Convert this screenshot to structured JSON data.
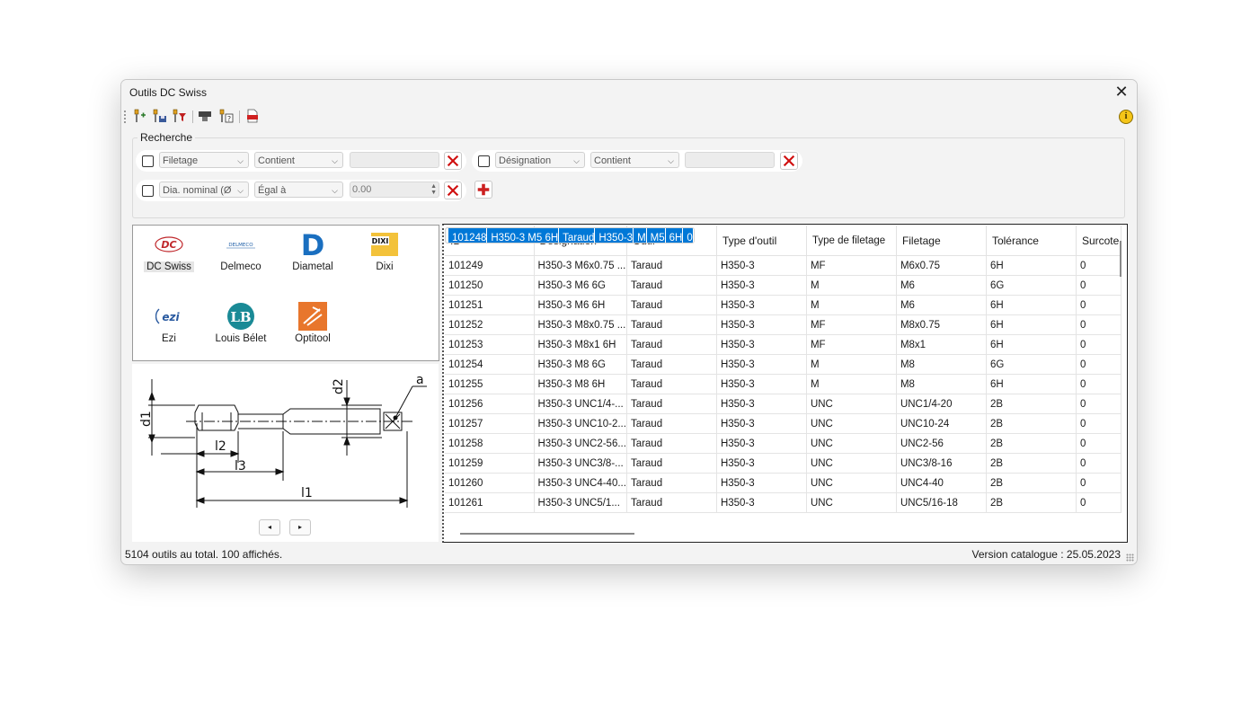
{
  "window": {
    "title": "Outils DC Swiss",
    "close_glyph": "✕"
  },
  "toolbar": {
    "icons": [
      "tool-add-icon",
      "tool-save-icon",
      "tool-filter-icon",
      "holder-icon",
      "tool-help-icon",
      "pdf-icon"
    ],
    "info_glyph": "i"
  },
  "search": {
    "label": "Recherche",
    "filters": [
      {
        "field": "Filetage",
        "op": "Contient",
        "value": ""
      },
      {
        "field": "Désignation",
        "op": "Contient",
        "value": ""
      },
      {
        "field": "Dia. nominal (Ø",
        "op": "Égal à",
        "value": "0.00"
      }
    ]
  },
  "brands": [
    {
      "name": "DC Swiss",
      "selected": true
    },
    {
      "name": "Delmeco"
    },
    {
      "name": "Diametal"
    },
    {
      "name": "Dixi"
    },
    {
      "name": "Ezi"
    },
    {
      "name": "Louis Bélet"
    },
    {
      "name": "Optitool"
    }
  ],
  "brand_logo_text": {
    "dc": "DC",
    "delmeco": "DELMECO",
    "diametal": "D",
    "dixi": "DIXI",
    "ezi": "ezi",
    "lb": "LB"
  },
  "drawing_labels": {
    "d1": "d1",
    "d2": "d2",
    "a": "a",
    "l1": "l1",
    "l2": "l2",
    "l3": "l3"
  },
  "nav": {
    "prev": "◂",
    "next": "▸"
  },
  "table": {
    "columns": [
      "ID",
      "Désignation",
      "Outil",
      "Type d'outil",
      "Type de filetage",
      "Filetage",
      "Tolérance",
      "Surcote"
    ],
    "rows": [
      [
        "101248",
        "H350-3 M5 6H",
        "Taraud",
        "H350-3",
        "M",
        "M5",
        "6H",
        "0"
      ],
      [
        "101249",
        "H350-3 M6x0.75 ...",
        "Taraud",
        "H350-3",
        "MF",
        "M6x0.75",
        "6H",
        "0"
      ],
      [
        "101250",
        "H350-3 M6 6G",
        "Taraud",
        "H350-3",
        "M",
        "M6",
        "6G",
        "0"
      ],
      [
        "101251",
        "H350-3 M6 6H",
        "Taraud",
        "H350-3",
        "M",
        "M6",
        "6H",
        "0"
      ],
      [
        "101252",
        "H350-3 M8x0.75 ...",
        "Taraud",
        "H350-3",
        "MF",
        "M8x0.75",
        "6H",
        "0"
      ],
      [
        "101253",
        "H350-3 M8x1 6H",
        "Taraud",
        "H350-3",
        "MF",
        "M8x1",
        "6H",
        "0"
      ],
      [
        "101254",
        "H350-3 M8 6G",
        "Taraud",
        "H350-3",
        "M",
        "M8",
        "6G",
        "0"
      ],
      [
        "101255",
        "H350-3 M8 6H",
        "Taraud",
        "H350-3",
        "M",
        "M8",
        "6H",
        "0"
      ],
      [
        "101256",
        "H350-3 UNC1/4-...",
        "Taraud",
        "H350-3",
        "UNC",
        "UNC1/4-20",
        "2B",
        "0"
      ],
      [
        "101257",
        "H350-3 UNC10-2...",
        "Taraud",
        "H350-3",
        "UNC",
        "UNC10-24",
        "2B",
        "0"
      ],
      [
        "101258",
        "H350-3 UNC2-56...",
        "Taraud",
        "H350-3",
        "UNC",
        "UNC2-56",
        "2B",
        "0"
      ],
      [
        "101259",
        "H350-3 UNC3/8-...",
        "Taraud",
        "H350-3",
        "UNC",
        "UNC3/8-16",
        "2B",
        "0"
      ],
      [
        "101260",
        "H350-3 UNC4-40...",
        "Taraud",
        "H350-3",
        "UNC",
        "UNC4-40",
        "2B",
        "0"
      ],
      [
        "101261",
        "H350-3 UNC5/1...",
        "Taraud",
        "H350-3",
        "UNC",
        "UNC5/16-18",
        "2B",
        "0"
      ]
    ],
    "selected_row": 0
  },
  "status": {
    "left": "5104 outils au total.  100 affichés.",
    "right": "Version catalogue : 25.05.2023"
  },
  "colors": {
    "selection": "#0078d7",
    "delete_x": "#d01010",
    "add_plus": "#cc2020"
  }
}
